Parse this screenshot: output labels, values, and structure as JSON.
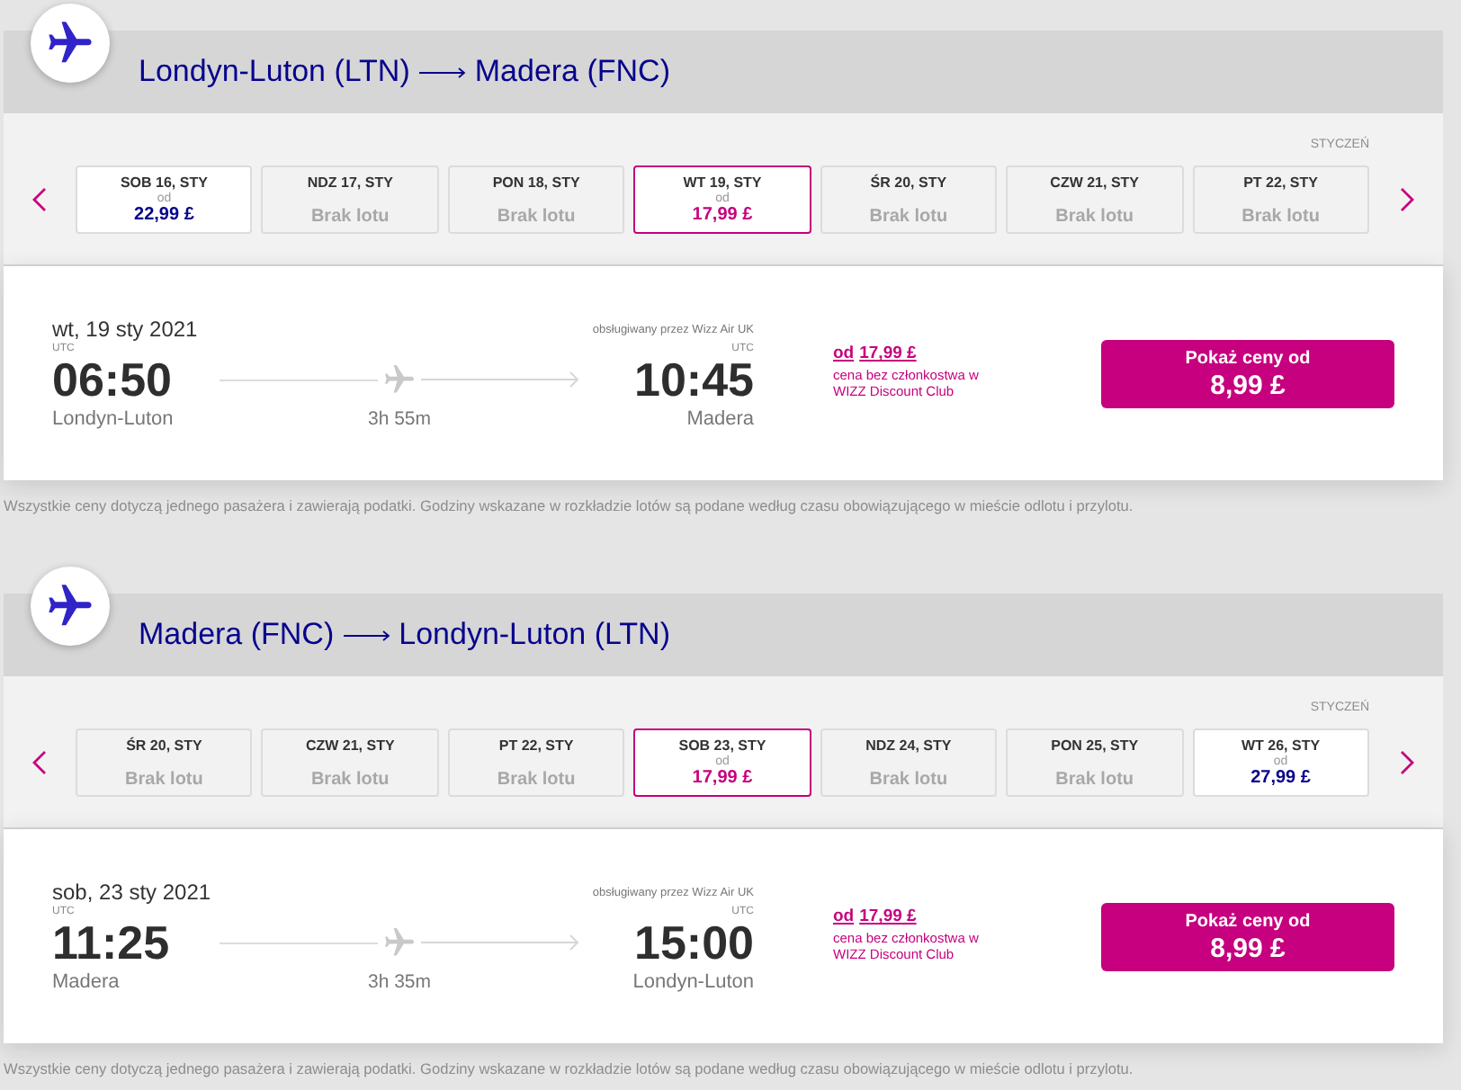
{
  "legs": [
    {
      "route": {
        "origin": "Londyn-Luton (LTN)",
        "destination": "Madera (FNC)"
      },
      "month": "STYCZEŃ",
      "dates": [
        {
          "kind": "fare",
          "day": "SOB 16, STY",
          "from": "od",
          "price": "22,99 £",
          "selected": false
        },
        {
          "kind": "no-flight",
          "day": "NDZ 17, STY",
          "status": "Brak lotu",
          "selected": false
        },
        {
          "kind": "no-flight",
          "day": "PON 18, STY",
          "status": "Brak lotu",
          "selected": false
        },
        {
          "kind": "fare",
          "day": "WT 19, STY",
          "from": "od",
          "price": "17,99 £",
          "selected": true
        },
        {
          "kind": "no-flight",
          "day": "ŚR 20, STY",
          "status": "Brak lotu",
          "selected": false
        },
        {
          "kind": "no-flight",
          "day": "CZW 21, STY",
          "status": "Brak lotu",
          "selected": false
        },
        {
          "kind": "no-flight",
          "day": "PT 22, STY",
          "status": "Brak lotu",
          "selected": false
        }
      ],
      "flight": {
        "date": "wt, 19 sty 2021",
        "operator": "obsługiwany przez Wizz Air UK",
        "departure": {
          "zone": "UTC",
          "time": "06:50",
          "city": "Londyn-Luton"
        },
        "duration": "3h 55m",
        "arrival": {
          "zone": "UTC",
          "time": "10:45",
          "city": "Madera"
        },
        "standard_fare": {
          "prefix": "od",
          "price": "17,99 £",
          "note": "cena bez członkostwa w WIZZ Discount Club"
        },
        "discount_button": {
          "label": "Pokaż ceny od",
          "price": "8,99 £"
        }
      },
      "footnote": "Wszystkie ceny dotyczą jednego pasażera i zawierają podatki. Godziny wskazane w rozkładzie lotów są podane według czasu obowiązującego w mieście odlotu i przylotu."
    },
    {
      "route": {
        "origin": "Madera (FNC)",
        "destination": "Londyn-Luton (LTN)"
      },
      "month": "STYCZEŃ",
      "dates": [
        {
          "kind": "no-flight",
          "day": "ŚR 20, STY",
          "status": "Brak lotu",
          "selected": false
        },
        {
          "kind": "no-flight",
          "day": "CZW 21, STY",
          "status": "Brak lotu",
          "selected": false
        },
        {
          "kind": "no-flight",
          "day": "PT 22, STY",
          "status": "Brak lotu",
          "selected": false
        },
        {
          "kind": "fare",
          "day": "SOB 23, STY",
          "from": "od",
          "price": "17,99 £",
          "selected": true
        },
        {
          "kind": "no-flight",
          "day": "NDZ 24, STY",
          "status": "Brak lotu",
          "selected": false
        },
        {
          "kind": "no-flight",
          "day": "PON 25, STY",
          "status": "Brak lotu",
          "selected": false
        },
        {
          "kind": "fare",
          "day": "WT 26, STY",
          "from": "od",
          "price": "27,99 £",
          "selected": false
        }
      ],
      "flight": {
        "date": "sob, 23 sty 2021",
        "operator": "obsługiwany przez Wizz Air UK",
        "departure": {
          "zone": "UTC",
          "time": "11:25",
          "city": "Madera"
        },
        "duration": "3h 35m",
        "arrival": {
          "zone": "UTC",
          "time": "15:00",
          "city": "Londyn-Luton"
        },
        "standard_fare": {
          "prefix": "od",
          "price": "17,99 £",
          "note": "cena bez członkostwa w WIZZ Discount Club"
        },
        "discount_button": {
          "label": "Pokaż ceny od",
          "price": "8,99 £"
        }
      },
      "footnote": "Wszystkie ceny dotyczą jednego pasażera i zawierają podatki. Godziny wskazane w rozkładzie lotów są podane według czasu obowiązującego w mieście odlotu i przylotu."
    }
  ]
}
